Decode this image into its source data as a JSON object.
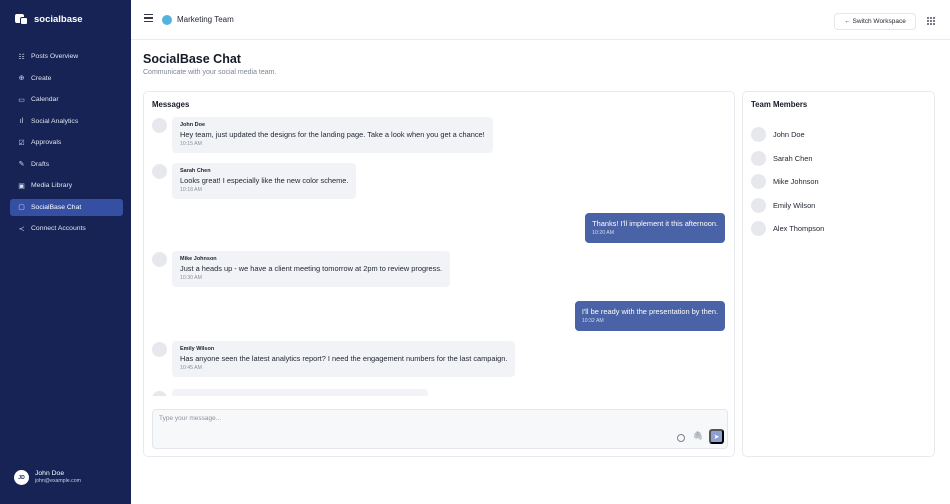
{
  "brand": {
    "name": "socialbase"
  },
  "sidebar": {
    "items": [
      {
        "label": "Posts Overview",
        "icon": "list-icon",
        "glyph": "☷"
      },
      {
        "label": "Create",
        "icon": "plus-circle-icon",
        "glyph": "⊕"
      },
      {
        "label": "Calendar",
        "icon": "calendar-icon",
        "glyph": "▭"
      },
      {
        "label": "Social Analytics",
        "icon": "bar-chart-icon",
        "glyph": "ıl"
      },
      {
        "label": "Approvals",
        "icon": "check-document-icon",
        "glyph": "☑"
      },
      {
        "label": "Drafts",
        "icon": "edit-document-icon",
        "glyph": "✎"
      },
      {
        "label": "Media Library",
        "icon": "image-icon",
        "glyph": "▣"
      },
      {
        "label": "SocialBase Chat",
        "icon": "chat-icon",
        "glyph": "▢"
      },
      {
        "label": "Connect Accounts",
        "icon": "share-icon",
        "glyph": "≺"
      }
    ],
    "active_index": 7,
    "user": {
      "initials": "JD",
      "name": "John Doe",
      "email": "john@example.com"
    }
  },
  "topbar": {
    "team_name": "Marketing Team",
    "switch_label": "← Switch Workspace"
  },
  "page": {
    "title": "SocialBase Chat",
    "subtitle": "Communicate with your social media team."
  },
  "messages_panel": {
    "title": "Messages",
    "messages": [
      {
        "direction": "in",
        "sender": "John Doe",
        "text": "Hey team, just updated the designs for the landing page. Take a look when you get a chance!",
        "time": "10:15 AM"
      },
      {
        "direction": "in",
        "sender": "Sarah Chen",
        "text": "Looks great! I especially like the new color scheme.",
        "time": "10:18 AM"
      },
      {
        "direction": "out",
        "sender": "",
        "text": "Thanks! I'll implement it this afternoon.",
        "time": "10:20 AM"
      },
      {
        "direction": "in",
        "sender": "Mike Johnson",
        "text": "Just a heads up - we have a client meeting tomorrow at 2pm to review progress.",
        "time": "10:30 AM"
      },
      {
        "direction": "out",
        "sender": "",
        "text": "I'll be ready with the presentation by then.",
        "time": "10:32 AM"
      },
      {
        "direction": "in",
        "sender": "Emily Wilson",
        "text": "Has anyone seen the latest analytics report? I need the engagement numbers for the last campaign.",
        "time": "10:45 AM"
      }
    ],
    "composer_placeholder": "Type your message..."
  },
  "team_panel": {
    "title": "Team Members",
    "members": [
      "John Doe",
      "Sarah Chen",
      "Mike Johnson",
      "Emily Wilson",
      "Alex Thompson"
    ]
  },
  "colors": {
    "sidebar_bg": "#172354",
    "active_nav": "#3550a3",
    "outgoing_bubble": "#4a62a6",
    "team_dot": "#53b3de",
    "send_button": "#8ea1d3"
  }
}
